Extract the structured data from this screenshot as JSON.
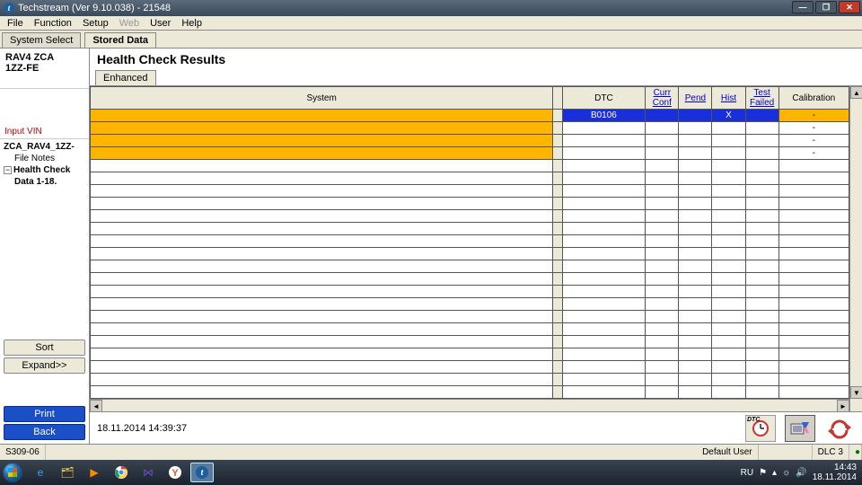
{
  "window": {
    "title": "Techstream (Ver 9.10.038) - 21548",
    "min_glyph": "—",
    "max_glyph": "❐",
    "close_glyph": "✕"
  },
  "menu": {
    "file": "File",
    "function": "Function",
    "setup": "Setup",
    "web": "Web",
    "user": "User",
    "help": "Help"
  },
  "subtabs": {
    "system_select": "System Select",
    "stored_data": "Stored Data"
  },
  "sidebar": {
    "model_line1": "RAV4 ZCA",
    "model_line2": "1ZZ-FE",
    "input_vin_label": "Input VIN",
    "tree": {
      "root": "ZCA_RAV4_1ZZ-",
      "file_notes": "File Notes",
      "health_check": "Health Check",
      "data_entry": "Data 1-18."
    },
    "sort_label": "Sort",
    "expand_label": "Expand>>",
    "print_label": "Print",
    "back_label": "Back"
  },
  "main": {
    "title": "Health Check Results",
    "tab_enhanced": "Enhanced",
    "columns": {
      "system": "System",
      "dtc": "DTC",
      "curr_conf": "Curr Conf",
      "pend": "Pend",
      "hist": "Hist",
      "test_failed": "Test Failed",
      "calibration": "Calibration"
    },
    "rows": [
      {
        "system": "",
        "dtc": "B0106",
        "curr_conf": "",
        "pend": "",
        "hist": "X",
        "test_failed": "",
        "calibration": "-",
        "highlight": true,
        "dtc_row": true
      },
      {
        "system": "",
        "dtc": "",
        "curr_conf": "",
        "pend": "",
        "hist": "",
        "test_failed": "",
        "calibration": "-",
        "highlight": true
      },
      {
        "system": "",
        "dtc": "",
        "curr_conf": "",
        "pend": "",
        "hist": "",
        "test_failed": "",
        "calibration": "-",
        "highlight": true
      },
      {
        "system": "",
        "dtc": "",
        "curr_conf": "",
        "pend": "",
        "hist": "",
        "test_failed": "",
        "calibration": "-",
        "highlight": true
      }
    ],
    "footer_timestamp": "18.11.2014 14:39:37",
    "dtc_icon_label": "DTC"
  },
  "statusbar": {
    "code": "S309-06",
    "default_user": "Default User",
    "dlc": "DLC 3"
  },
  "taskbar": {
    "lang": "RU",
    "time": "14:43",
    "date": "18.11.2014"
  }
}
